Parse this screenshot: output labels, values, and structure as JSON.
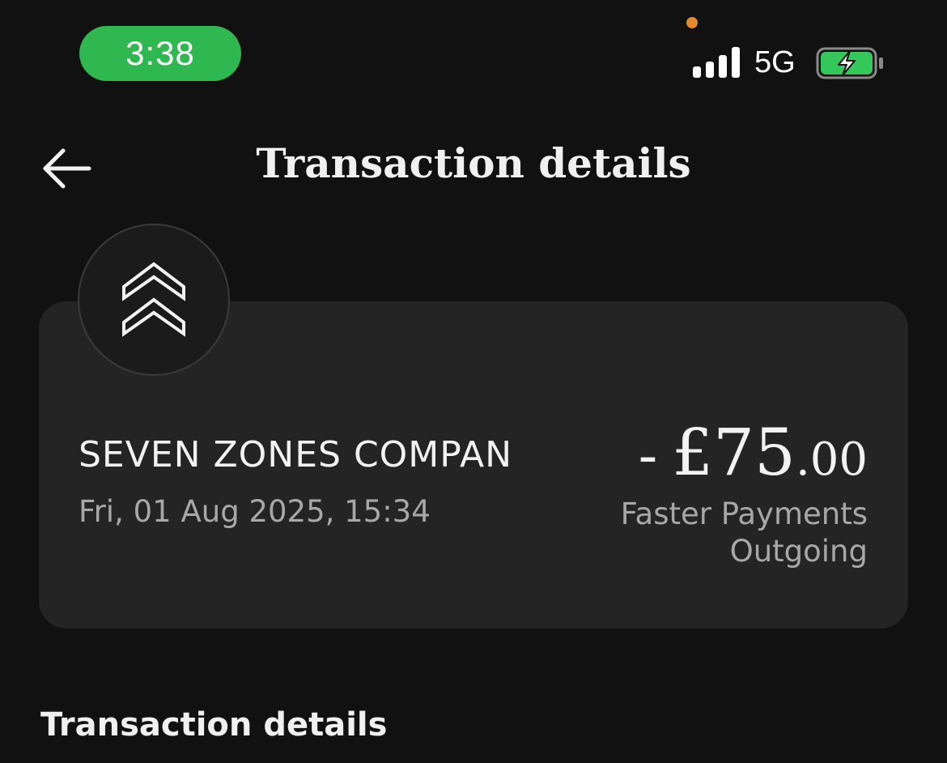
{
  "status_bar": {
    "time": "3:38",
    "network": "5G",
    "icons": [
      "signal-icon",
      "battery-charging-icon"
    ],
    "colors": {
      "time_pill": "#2eb84f",
      "privacy_dot": "#e38b2c",
      "battery_fill": "#34c759"
    }
  },
  "header": {
    "back_icon": "arrow-left-icon",
    "title": "Transaction details"
  },
  "transaction": {
    "merchant_icon": "double-chevron-up-icon",
    "merchant_name": "SEVEN ZONES COMPAN",
    "date": "Fri, 01 Aug 2025, 15:34",
    "amount_sign": "-",
    "amount_major": "£75",
    "amount_minor": ".00",
    "payment_type_line1": "Faster Payments",
    "payment_type_line2": "Outgoing"
  },
  "section": {
    "heading": "Transaction details"
  },
  "theme": {
    "background": "#111111",
    "card": "#242424",
    "primary_text": "#f2f2f2",
    "secondary_text": "#a8a8a8"
  }
}
